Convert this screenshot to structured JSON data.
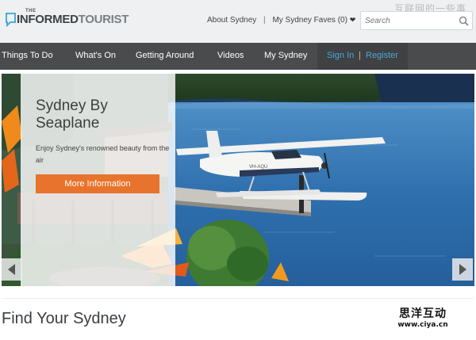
{
  "header": {
    "logo_small": "THE",
    "logo_main": "INFORMED",
    "logo_light": "TOURIST",
    "links": [
      "About Sydney",
      "My Sydney Faves (0)"
    ],
    "heart": "❤",
    "search_placeholder": "Search",
    "watermark_top": "互联网的一些事"
  },
  "nav": {
    "items": [
      "Things To Do",
      "What's On",
      "Getting Around",
      "Videos",
      "My Sydney"
    ],
    "sign_in": "Sign In",
    "register": "Register",
    "separator": "|"
  },
  "hero": {
    "title": "Sydney By Seaplane",
    "description": "Enjoy Sydney's renowned beauty from the air",
    "button": "More Information",
    "plane_reg": "VH-AQU"
  },
  "section": {
    "title": "Find Your Sydney"
  },
  "watermark": {
    "chinese": "思洋互动",
    "url": "www.ciya.cn"
  },
  "colors": {
    "nav_bg": "#494b4d",
    "accent_orange": "#e8732c",
    "link_blue": "#4aa8d8",
    "water": "#3b78b4"
  }
}
